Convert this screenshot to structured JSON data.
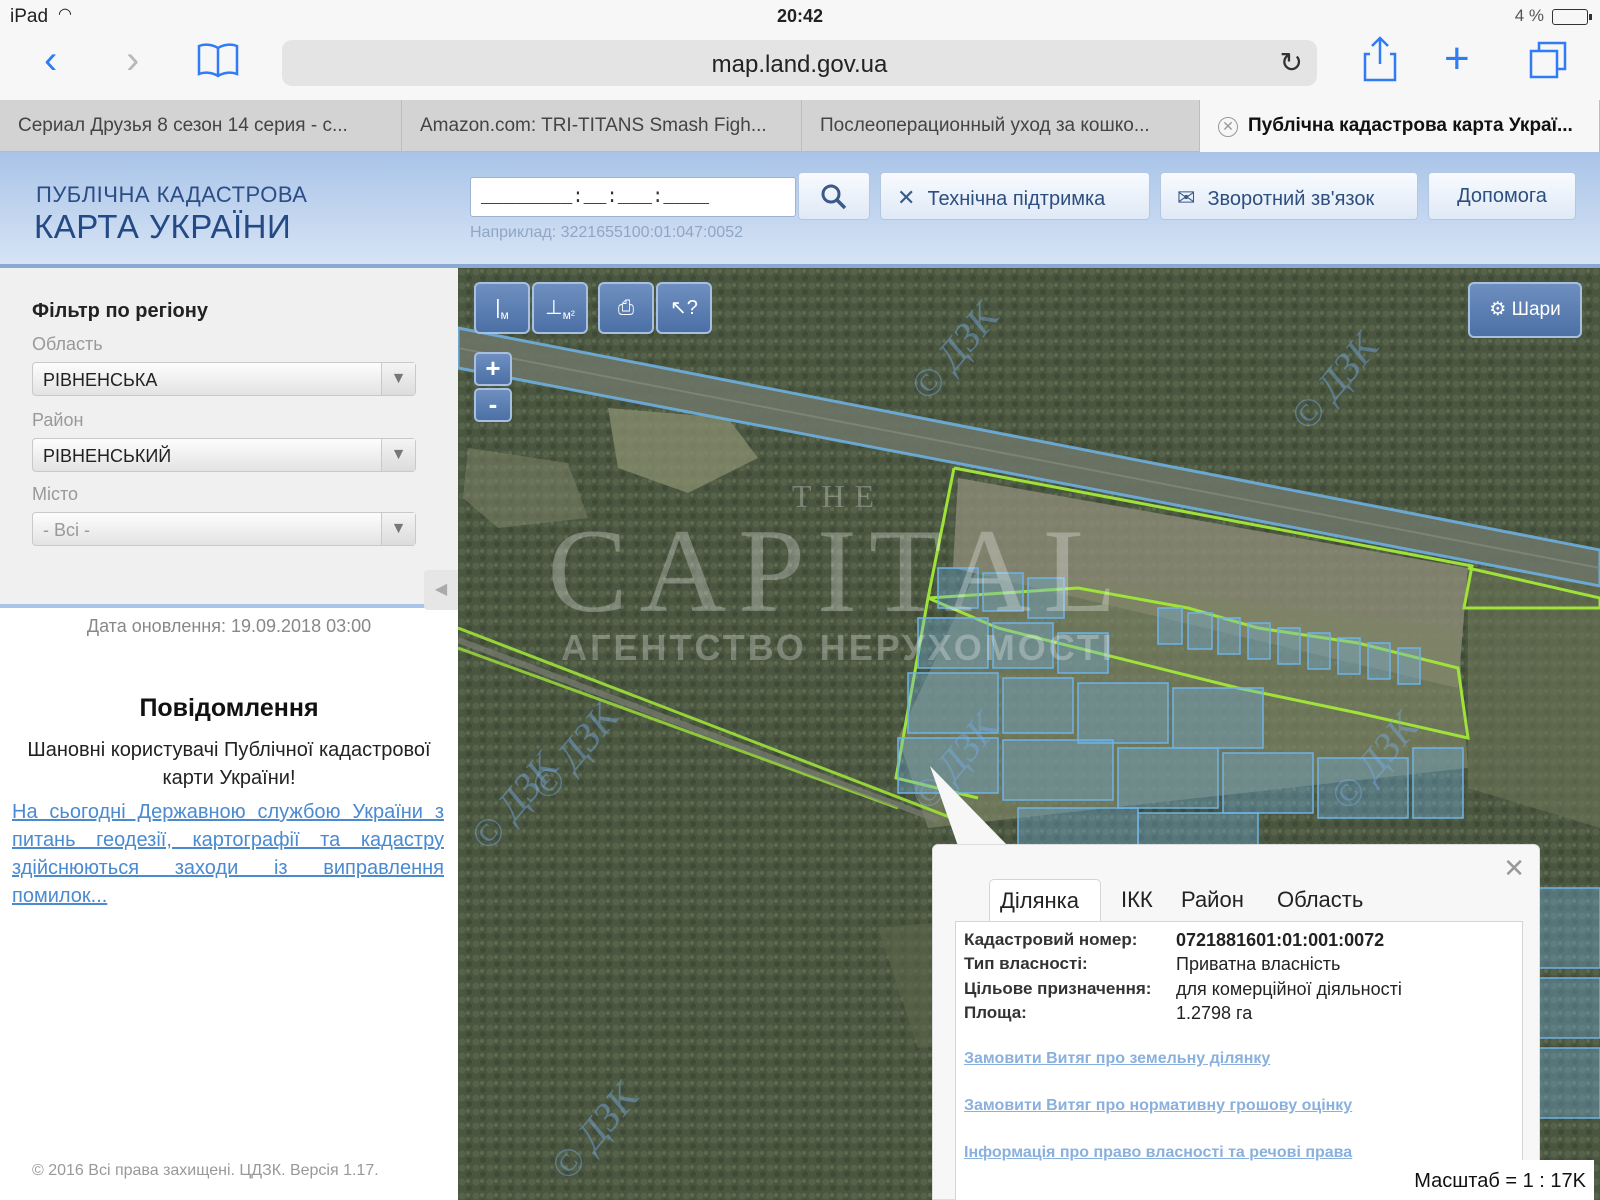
{
  "status_bar": {
    "device": "iPad",
    "time": "20:42",
    "battery": "4 %"
  },
  "browser": {
    "url": "map.land.gov.ua",
    "tabs": [
      {
        "title": "Сериал Друзья 8 сезон 14 серия - с...",
        "active": false
      },
      {
        "title": "Amazon.com: TRI-TITANS Smash Figh...",
        "active": false
      },
      {
        "title": "Послеоперационный уход за кошко...",
        "active": false
      },
      {
        "title": "Публічна кадастрова карта Украї...",
        "active": true
      }
    ]
  },
  "header": {
    "logo_line1": "ПУБЛІЧНА КАДАСТРОВА",
    "logo_line2": "КАРТА УКРАЇНИ",
    "search_value": "________:__:___:____",
    "search_hint": "Наприклад: 3221655100:01:047:0052",
    "buttons": {
      "support": "Технічна підтримка",
      "feedback": "Зворотний зв'язок",
      "help": "Допомога"
    }
  },
  "sidebar": {
    "filter_title": "Фільтр по регіону",
    "oblast_label": "Область",
    "oblast_value": "РІВНЕНСЬКА",
    "raion_label": "Район",
    "raion_value": "РІВНЕНСЬКИЙ",
    "misto_label": "Місто",
    "misto_value": "- Всі -",
    "updated": "Дата оновлення: 19.09.2018 03:00",
    "notice_title": "Повідомлення",
    "notice_text": "Шановні користувачі Публічної кадастрової карти України!",
    "notice_link": "На сьогодні Державною службою України з питань геодезії, картографії та кадастру здійснюються заходи із виправлення помилок...",
    "copyright": "© 2016 Всі права захищені. ЦДЗК. Версія 1.17."
  },
  "map": {
    "tools": {
      "measure_length": "м",
      "measure_area": "м²"
    },
    "zoom_in": "+",
    "zoom_out": "-",
    "layers_label": "Шари",
    "watermark": {
      "line1": "THE",
      "line2": "CAPITAL",
      "line3": "АГЕНТСТВО НЕРУХОМОСТІ"
    },
    "overlay_mark": "© ДЗК",
    "scale": "Масштаб = 1 : 17K"
  },
  "popup": {
    "tabs": [
      "Ділянка",
      "ІКК",
      "Район",
      "Область"
    ],
    "fields": [
      {
        "label": "Кадастровий номер:",
        "value": "0721881601:01:001:0072"
      },
      {
        "label": "Тип власності:",
        "value": "Приватна власність"
      },
      {
        "label": "Цільове призначення:",
        "value": "для комерційної діяльності"
      },
      {
        "label": "Площа:",
        "value": "1.2798 га"
      }
    ],
    "links": [
      "Замовити Витяг про земельну ділянку",
      "Замовити Витяг про нормативну грошову оцінку",
      "Інформація про право власності та речові права"
    ]
  },
  "colors": {
    "accent": "#2f7cf6",
    "header_bg": "#a9c4e8",
    "parcel_green": "#9fe23a",
    "parcel_blue": "#6fb3e6"
  }
}
